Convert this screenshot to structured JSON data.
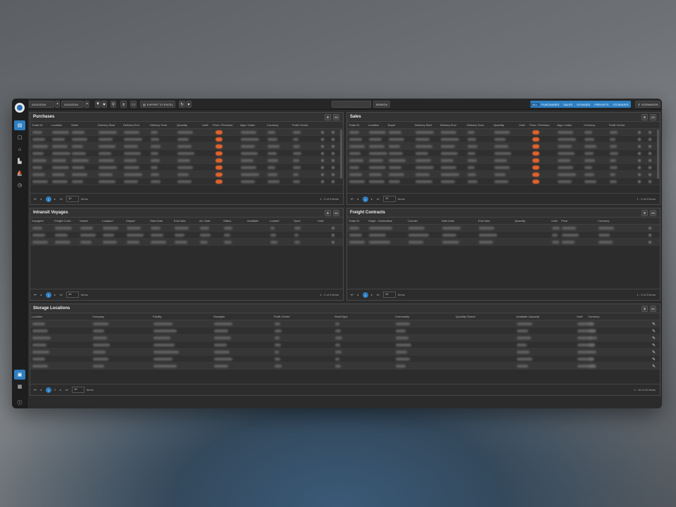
{
  "toolbar": {
    "date_from": "01/01/2024",
    "date_to": "31/01/2024",
    "export_label": "EXPORT TO EXCEL",
    "search_placeholder": "",
    "search_button": "SEARCH",
    "filters": [
      "ALL",
      "PURCHASES",
      "SALES",
      "VOYAGES",
      "FREIGHTS",
      "STORAGES"
    ],
    "scenarios_label": "SCENARIOS"
  },
  "purchases": {
    "title": "Purchases",
    "columns": [
      "Trade ID",
      "Location",
      "Seller",
      "Delivery Start",
      "Delivery End",
      "Delivery Term",
      "Quantity",
      "UoM",
      "Price / Premium",
      "Algo / Index",
      "Currency",
      "Profit Centre"
    ],
    "pager": {
      "page": "1",
      "size": "10",
      "items_label": "Items",
      "info": "1 - 9 of 9 items"
    }
  },
  "sales": {
    "title": "Sales",
    "columns": [
      "Trade ID",
      "Location",
      "Buyer",
      "Delivery Start",
      "Delivery End",
      "Delivery Term",
      "Quantity",
      "UoM",
      "Price / Premium",
      "Algo / Index",
      "Currency",
      "Profit Centre"
    ],
    "pager": {
      "page": "1",
      "size": "10",
      "items_label": "Items",
      "info": "1 - 9 of 9 items"
    }
  },
  "voyages": {
    "title": "Intransit Voyages",
    "columns": [
      "VoyageId",
      "Freight Contr...",
      "Vessel",
      "Loadport",
      "Disport",
      "Start Date",
      "End Date",
      "Arr. Date",
      "Status",
      "Available",
      "Loaded",
      "Open",
      "UoM"
    ],
    "pager": {
      "page": "1",
      "size": "10",
      "items_label": "Items",
      "info": "1 - 2 of 2 items"
    }
  },
  "freight": {
    "title": "Freight Contracts",
    "columns": [
      "Trade ID",
      "Origin - Destination",
      "Counter",
      "Start Date",
      "End Date",
      "Quantity",
      "UoM",
      "Price",
      "Currency"
    ],
    "pager": {
      "page": "1",
      "size": "10",
      "items_label": "Items",
      "info": "1 - 3 of 3 items"
    }
  },
  "storage": {
    "title": "Storage Locations",
    "columns": [
      "Location",
      "Company",
      "Facility",
      "Stockpile",
      "Profit Centre",
      "StockType",
      "Commodity",
      "Quantity Stored",
      "Available Capacity",
      "UoM",
      "Currency"
    ],
    "pager": {
      "page": "1",
      "page2": "2",
      "size": "10",
      "items_label": "Items",
      "info": "1 - 10 of 12 items"
    }
  },
  "colors": {
    "accent": "#2d7fc1",
    "highlight": "#e0622e"
  }
}
